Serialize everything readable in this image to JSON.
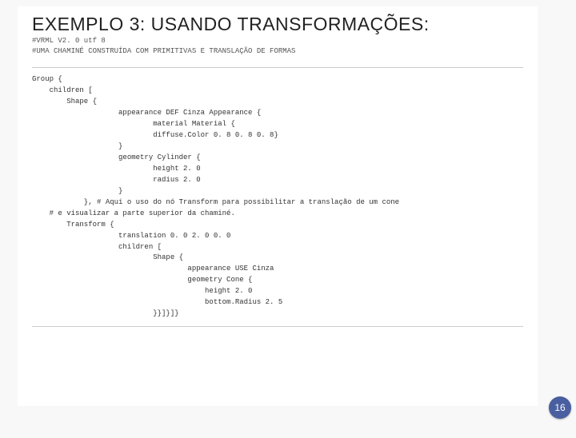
{
  "title": "EXEMPLO 3: USANDO TRANSFORMAÇÕES:",
  "subtitle_line1": "#VRML V2. 0 utf 8",
  "subtitle_line2": "#UMA CHAMINÉ CONSTRUÍDA COM PRIMITIVAS E TRANSLAÇÃO DE FORMAS",
  "code": "Group {\n    children [\n        Shape {\n                    appearance DEF Cinza Appearance {\n                            material Material {\n                            diffuse.Color 0. 8 0. 8 0. 8}\n                    }\n                    geometry Cylinder {\n                            height 2. 0\n                            radius 2. 0\n                    }\n            }, # Aqui o uso do nó Transform para possibilitar a translação de um cone\n    # e visualizar a parte superior da chaminé.\n        Transform {\n                    translation 0. 0 2. 0 0. 0\n                    children [\n                            Shape {\n                                    appearance USE Cinza\n                                    geometry Cone {\n                                        height 2. 0\n                                        bottom.Radius 2. 5\n                            }}]}]}",
  "page_number": "16"
}
